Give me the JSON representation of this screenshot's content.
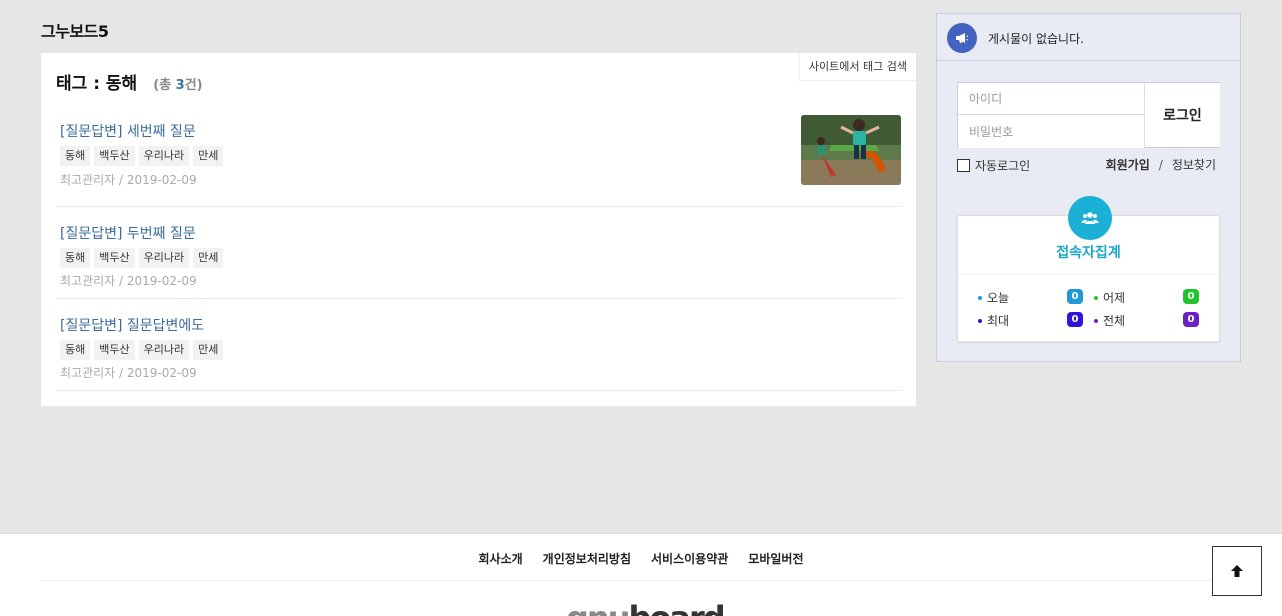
{
  "site": {
    "title": "그누보드5"
  },
  "main": {
    "tag_search_label": "사이트에서 태그 검색",
    "heading_prefix": "태그 : ",
    "heading_tag": "동해",
    "count_prefix": "(총 ",
    "count_value": "3",
    "count_suffix": "건)",
    "posts": [
      {
        "title": "[질문답변] 세번째 질문",
        "tags": [
          "동해",
          "백두산",
          "우리나라",
          "만세"
        ],
        "meta": "최고관리자 / 2019-02-09",
        "has_thumb": true
      },
      {
        "title": "[질문답변] 두번째 질문",
        "tags": [
          "동해",
          "백두산",
          "우리나라",
          "만세"
        ],
        "meta": "최고관리자 / 2019-02-09",
        "has_thumb": false
      },
      {
        "title": "[질문답변] 질문답변에도",
        "tags": [
          "동해",
          "백두산",
          "우리나라",
          "만세"
        ],
        "meta": "최고관리자 / 2019-02-09",
        "has_thumb": false
      }
    ]
  },
  "sidebar": {
    "notice_text": "게시물이 없습니다.",
    "notice_icon": "megaphone-icon",
    "login": {
      "id_placeholder": "아이디",
      "pw_placeholder": "비밀번호",
      "button": "로그인",
      "autologin": "자동로그인",
      "join": "회원가입",
      "separator": "/",
      "find": "정보찾기"
    },
    "visit": {
      "icon": "users-icon",
      "title": "접속자집계",
      "today_label": "오늘",
      "today_value": "0",
      "yesterday_label": "어제",
      "yesterday_value": "0",
      "max_label": "최대",
      "max_value": "0",
      "total_label": "전체",
      "total_value": "0",
      "colors": {
        "today": "#1e9bd7",
        "yesterday": "#22c42e",
        "max": "#3512d9",
        "total": "#6a22bf"
      }
    }
  },
  "footer": {
    "links": [
      "회사소개",
      "개인정보처리방침",
      "서비스이용약관",
      "모바일버전"
    ],
    "logo_part1": "gnu",
    "logo_part2": "board"
  },
  "top_button_icon": "arrow-up-icon"
}
